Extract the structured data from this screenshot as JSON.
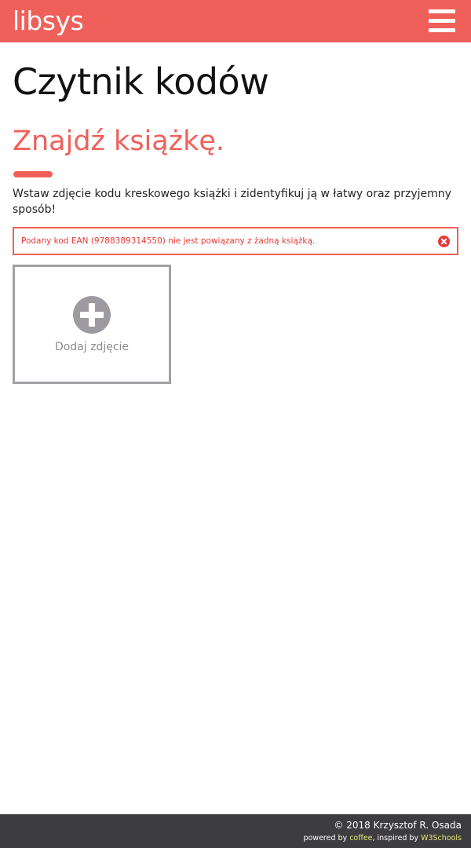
{
  "colors": {
    "accent": "#f0605a",
    "error": "#e53935",
    "footer_bg": "#3d3d3f",
    "link": "#e6e67a",
    "tile_border": "#a0a0a6"
  },
  "header": {
    "logo": "libsys",
    "menu_icon": "hamburger-menu-icon"
  },
  "main": {
    "page_title": "Czytnik kodów",
    "section_title": "Znajdź książkę.",
    "description": "Wstaw zdjęcie kodu kreskowego książki i zidentyfikuj ją w łatwy oraz przyjemny sposób!",
    "alert": {
      "message": "Podany kod EAN (9788389314550) nie jest powiązany z żadną książką.",
      "close_icon": "close-circle-icon"
    },
    "upload": {
      "label": "Dodaj zdjęcie",
      "icon": "plus-circle-icon"
    }
  },
  "footer": {
    "copyright": "© 2018 Krzysztof R. Osada",
    "powered_by_prefix": "powered by ",
    "powered_by_link": "coffee",
    "inspired_by_prefix": ", inspired by ",
    "inspired_by_link": "W3Schools"
  }
}
